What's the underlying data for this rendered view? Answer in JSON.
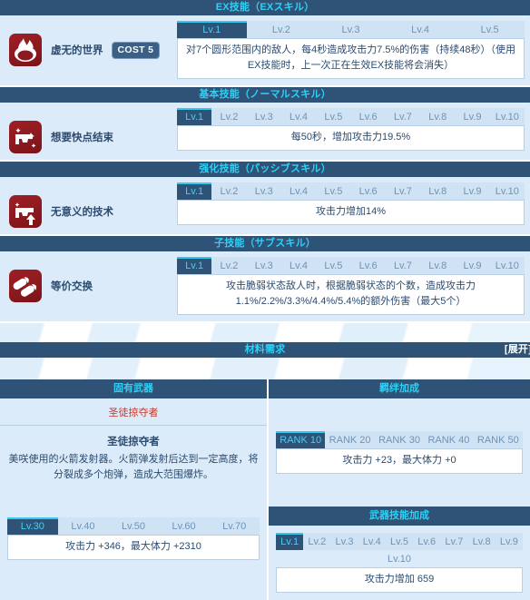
{
  "sections": {
    "ex": {
      "header": "EX技能（EXスキル）",
      "skill_name": "虚无的世界",
      "cost_label": "COST 5",
      "icon": "flame-icon",
      "tabs": [
        "Lv.1",
        "Lv.2",
        "Lv.3",
        "Lv.4",
        "Lv.5"
      ],
      "active_tab": 0,
      "description": "对7个圆形范围内的敌人，每4秒造成攻击力7.5%的伤害（持续48秒）（使用EX技能时，上一次正在生效EX技能将会消失）"
    },
    "normal": {
      "header": "基本技能（ノーマルスキル）",
      "skill_name": "想要快点结束",
      "icon": "pistol-sparkle-icon",
      "tabs": [
        "Lv.1",
        "Lv.2",
        "Lv.3",
        "Lv.4",
        "Lv.5",
        "Lv.6",
        "Lv.7",
        "Lv.8",
        "Lv.9",
        "Lv.10"
      ],
      "active_tab": 0,
      "description": "每50秒，增加攻击力19.5%"
    },
    "passive": {
      "header": "强化技能（パッシブスキル）",
      "skill_name": "无意义的技术",
      "icon": "pistol-arrow-icon",
      "tabs": [
        "Lv.1",
        "Lv.2",
        "Lv.3",
        "Lv.4",
        "Lv.5",
        "Lv.6",
        "Lv.7",
        "Lv.8",
        "Lv.9",
        "Lv.10"
      ],
      "active_tab": 0,
      "description": "攻击力增加14%"
    },
    "sub": {
      "header": "子技能（サブスキル）",
      "skill_name": "等价交换",
      "icon": "bullets-icon",
      "tabs": [
        "Lv.1",
        "Lv.2",
        "Lv.3",
        "Lv.4",
        "Lv.5",
        "Lv.6",
        "Lv.7",
        "Lv.8",
        "Lv.9",
        "Lv.10"
      ],
      "active_tab": 0,
      "description": "攻击脆弱状态敌人时，根据脆弱状态的个数，造成攻击力1.1%/2.2%/3.3%/4.4%/5.4%的额外伤害（最大5个）"
    }
  },
  "materials": {
    "header": "材料需求",
    "expand_label": "[展开]"
  },
  "weapon": {
    "column_header": "固有武器",
    "title_red": "圣徒掠夺者",
    "name": "圣徒掠夺者",
    "description": "美咲使用的火箭发射器。火箭弹发射后达到一定高度，将分裂成多个炮弹，造成大范围爆炸。",
    "tabs": [
      "Lv.30",
      "Lv.40",
      "Lv.50",
      "Lv.60",
      "Lv.70"
    ],
    "active_tab": 0,
    "stat_text": "攻击力 +346，最大体力 +2310"
  },
  "bond": {
    "column_header": "羁绊加成",
    "tabs": [
      "RANK 10",
      "RANK 20",
      "RANK 30",
      "RANK 40",
      "RANK 50"
    ],
    "active_tab": 0,
    "stat_text": "攻击力 +23，最大体力 +0"
  },
  "weapon_skill": {
    "column_header": "武器技能加成",
    "tabs": [
      "Lv.1",
      "Lv.2",
      "Lv.3",
      "Lv.4",
      "Lv.5",
      "Lv.6",
      "Lv.7",
      "Lv.8",
      "Lv.9",
      "Lv.10"
    ],
    "active_tab": 0,
    "stat_text": "攻击力增加 659"
  },
  "colors": {
    "header_bg": "#2f5277",
    "header_text": "#2fd0f5",
    "panel_bg": "#dcebf9",
    "tab_active_bg": "#2f5277",
    "tab_active_text": "#3fd2f7",
    "tab_active_border": "#35c9ee",
    "tab_inactive_bg": "#cfe3f5",
    "tab_inactive_text": "#6f93b6",
    "icon_red": "#8b1a1f",
    "weapon_red": "#c0392b"
  }
}
